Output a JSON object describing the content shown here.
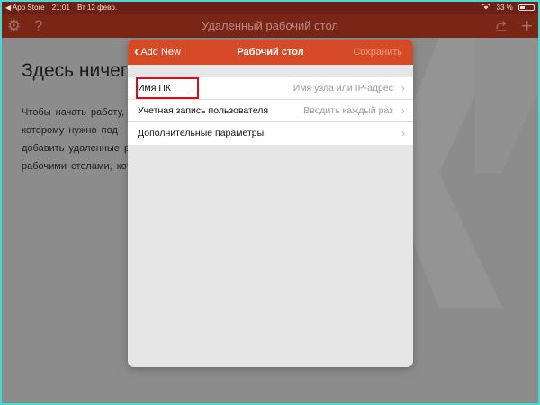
{
  "status_bar": {
    "back_app": "◀ App Store",
    "time": "21:01",
    "date": "Вт 12 февр.",
    "battery": "33 %"
  },
  "nav_bar": {
    "title": "Удаленный рабочий стол",
    "settings_icon": "gear-icon",
    "help_icon": "question-icon",
    "refresh_icon": "refresh-icon",
    "add_icon": "plus-icon"
  },
  "background": {
    "heading": "Здесь ничег",
    "paragraph_lines": [
      "Чтобы начать работу,",
      "которому нужно под",
      "добавить удаленные р",
      "рабочими столами, кот"
    ]
  },
  "modal": {
    "back_label": "Add New",
    "title": "Рабочий стол",
    "save_label": "Сохранить",
    "rows": [
      {
        "label": "Имя ПК",
        "value": "Имя узла или IP-адрес"
      },
      {
        "label": "Учетная запись пользователя",
        "value": "Вводить каждый раз"
      },
      {
        "label": "Дополнительные параметры",
        "value": ""
      }
    ]
  },
  "colors": {
    "header_orange": "#d64b27",
    "status_bar_dark": "#6d2116",
    "highlight_red": "#d0101c"
  }
}
